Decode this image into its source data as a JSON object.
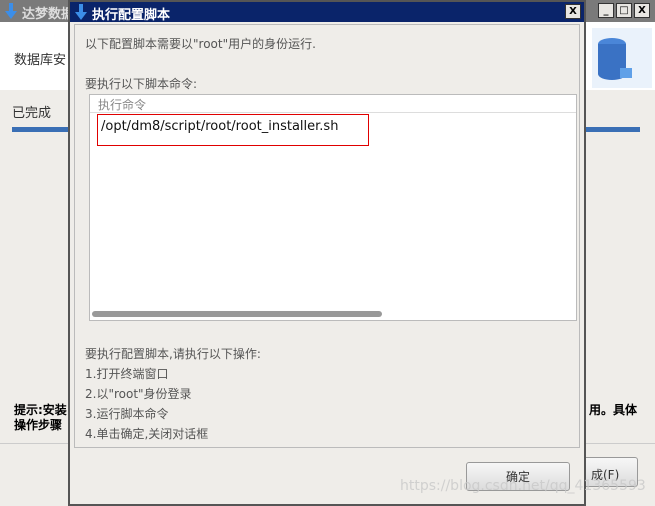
{
  "background_window": {
    "title": "达梦数据",
    "header_text": "数据库安",
    "status": "已完成",
    "hint_line1_left": "提示:安装",
    "hint_line2_left": "操作步骤",
    "hint_line1_right": "用。具体",
    "finish_button": "成(F)",
    "progress_percent": 100,
    "accent": "#3a6fb5"
  },
  "dialog": {
    "title": "执行配置脚本",
    "intro": "以下配置脚本需要以\"root\"用户的身份运行.",
    "command_label": "要执行以下脚本命令:",
    "column_header": "执行命令",
    "command": "/opt/dm8/script/root/root_installer.sh",
    "instructions_title": "要执行配置脚本,请执行以下操作:",
    "steps": [
      "1.打开终端窗口",
      "2.以\"root\"身份登录",
      "3.运行脚本命令",
      "4.单击确定,关闭对话框"
    ],
    "ok_button": "确定",
    "close_glyph": "X",
    "title_color": "#0a246a"
  },
  "watermark": "https://blog.csdn.net/qq_41365593"
}
